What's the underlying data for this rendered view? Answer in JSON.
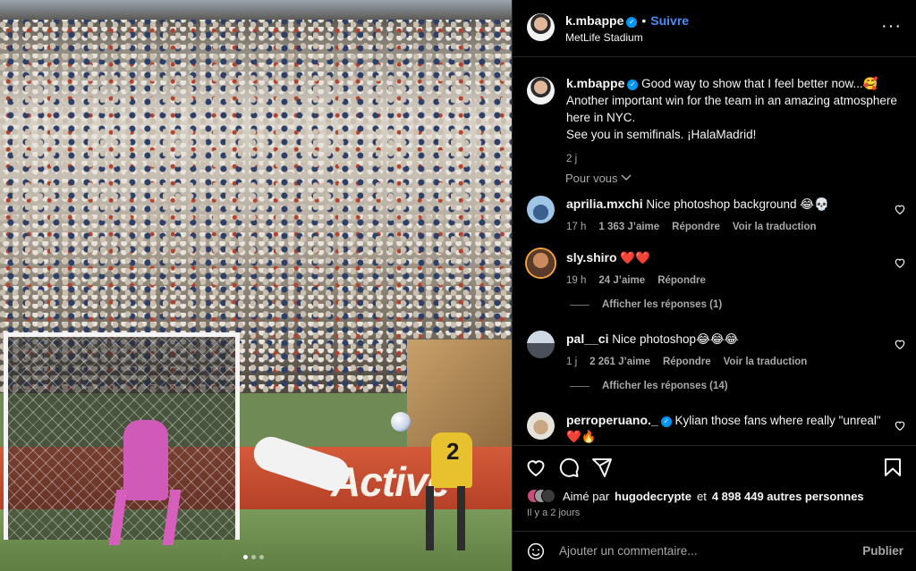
{
  "post": {
    "username": "k.mbappe",
    "follow_label": "Suivre",
    "location": "MetLife Stadium",
    "caption_line1": "Good way to show that I feel better now...🥰",
    "caption_line2": "Another important win for the team in an amazing atmosphere here in NYC.",
    "caption_line3": "See you in semifinals. ¡HalaMadrid!",
    "caption_time": "2 j",
    "for_you_label": "Pour vous"
  },
  "comments": [
    {
      "username": "aprilia.mxchi",
      "text": "Nice photoshop background 😂💀",
      "time": "17 h",
      "likes": "1 363 J’aime",
      "reply": "Répondre",
      "translate": "Voir la traduction"
    },
    {
      "username": "sly.shiro",
      "text": "❤️❤️",
      "time": "19 h",
      "likes": "24 J’aime",
      "reply": "Répondre",
      "replies_label": "Afficher les réponses (1)"
    },
    {
      "username": "pal__ci",
      "text": "Nice photoshop😂😂😂",
      "time": "1 j",
      "likes": "2 261 J’aime",
      "reply": "Répondre",
      "translate": "Voir la traduction",
      "replies_label": "Afficher les réponses (14)"
    },
    {
      "username": "perroperuano._",
      "text": "Kylian those fans where really \"unreal\" ❤️🔥"
    }
  ],
  "footer": {
    "liked_by_prefix": "Aimé par",
    "liked_by_user": "hugodecrypte",
    "liked_by_suffix": "et",
    "liked_count": "4 898 449 autres personnes",
    "time_ago": "Il y a 2 jours",
    "comment_placeholder": "Ajouter un commentaire...",
    "publish_label": "Publier"
  },
  "media": {
    "banner_text": "Active",
    "shirt_number": "2",
    "carousel_total": 3,
    "carousel_index": 1
  },
  "colors": {
    "accent": "#4a8df8",
    "verified": "#0095f6",
    "muted": "#a8a8a8"
  },
  "icons": [
    "verified-icon",
    "more-icon",
    "heart-icon",
    "comment-icon",
    "share-icon",
    "bookmark-icon",
    "emoji-icon",
    "chevron-down-icon"
  ]
}
